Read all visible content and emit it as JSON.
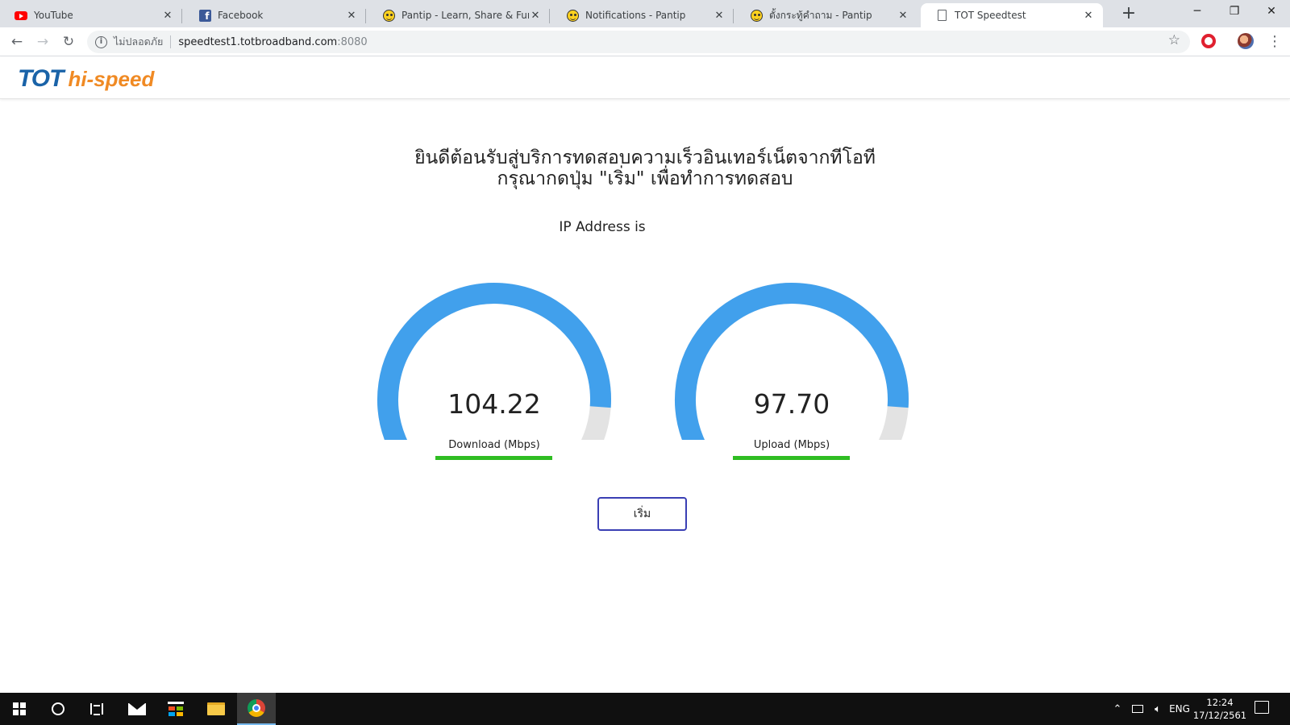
{
  "browser": {
    "tabs": [
      {
        "title": "YouTube",
        "favicon": "youtube-icon",
        "close": "✕"
      },
      {
        "title": "Facebook",
        "favicon": "facebook-icon",
        "close": "✕"
      },
      {
        "title": "Pantip - Learn, Share & Fun",
        "favicon": "pantip-icon",
        "close": "✕"
      },
      {
        "title": "Notifications - Pantip",
        "favicon": "pantip-icon",
        "close": "✕"
      },
      {
        "title": "ตั้งกระทู้คำถาม - Pantip",
        "favicon": "pantip-icon",
        "close": "✕"
      },
      {
        "title": "TOT Speedtest",
        "favicon": "document-icon",
        "close": "✕"
      }
    ],
    "new_tab": "+",
    "window_controls": {
      "minimize": "─",
      "maximize": "❐",
      "close": "✕"
    },
    "nav": {
      "back": "←",
      "forward": "→",
      "reload": "↻"
    },
    "address": {
      "security_label": "ไม่ปลอดภัย",
      "host": "speedtest1.totbroadband.com",
      "port": ":8080"
    },
    "star": "☆",
    "menu": "⋮"
  },
  "site": {
    "logo_primary": "TOT",
    "logo_secondary": "hi-speed",
    "welcome_line1": "ยินดีต้อนรับสู่บริการทดสอบความเร็วอินเทอร์เน็ตจากทีโอที",
    "welcome_line2": "กรุณากดปุ่ม \"เริ่ม\" เพื่อทำการทดสอบ",
    "ip_label": "IP Address is",
    "download": {
      "value": "104.22",
      "label": "Download (Mbps)",
      "fill": 0.9
    },
    "upload": {
      "value": "97.70",
      "label": "Upload (Mbps)",
      "fill": 0.9
    },
    "start_button": "เริ่ม",
    "colors": {
      "gauge_fill": "#41a0ec",
      "gauge_track": "#e3e3e3",
      "bar": "#2fbd22",
      "button_border": "#3a3fb4"
    }
  },
  "taskbar": {
    "language": "ENG",
    "time": "12:24",
    "date": "17/12/2561"
  }
}
